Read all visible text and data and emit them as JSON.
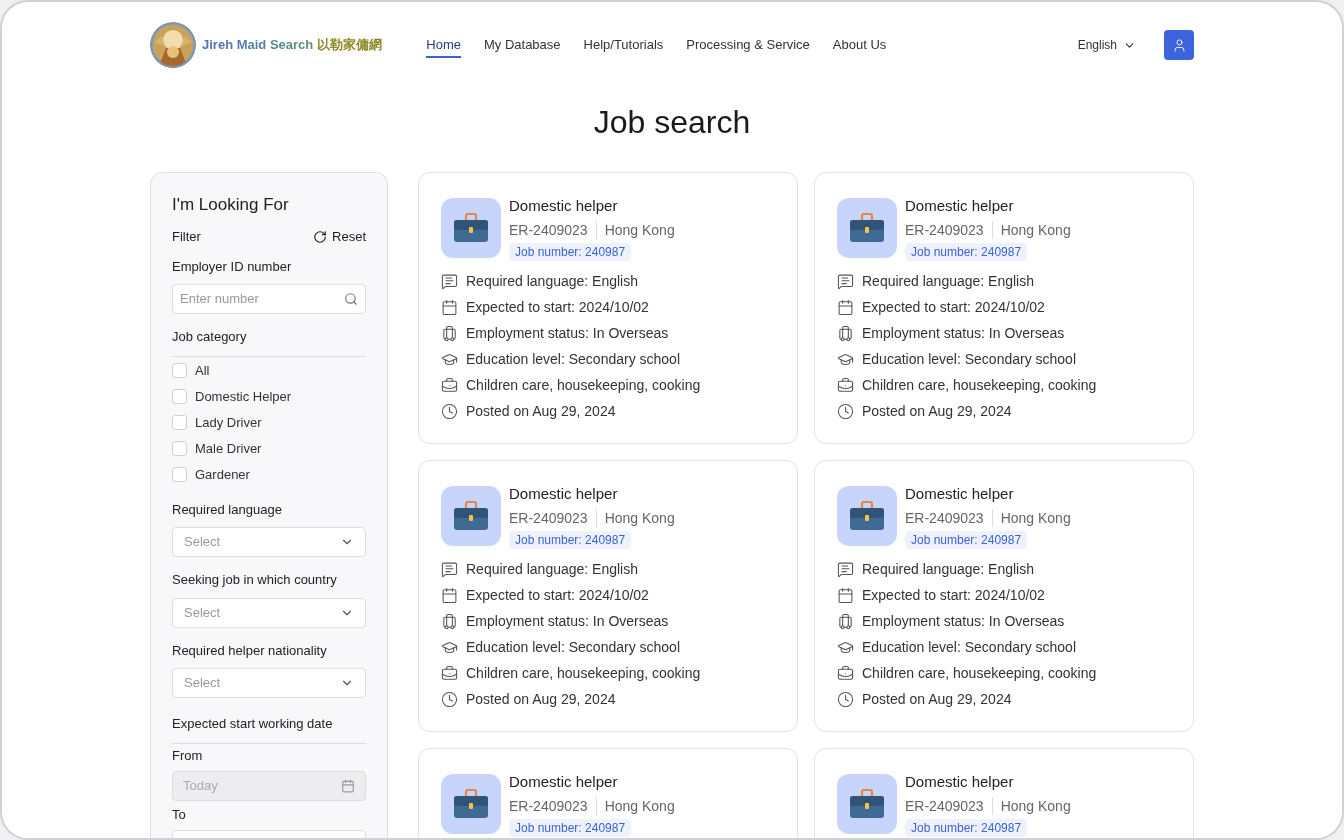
{
  "header": {
    "brand": {
      "name": "Jireh Maid Search",
      "chinese": "以勒家傭網"
    },
    "nav": [
      {
        "label": "Home",
        "selected": true
      },
      {
        "label": "My Database",
        "selected": false
      },
      {
        "label": "Help/Tutorials",
        "selected": false
      },
      {
        "label": "Processing & Service",
        "selected": false
      },
      {
        "label": "About Us",
        "selected": false
      }
    ],
    "language": "English"
  },
  "page_title": "Job search",
  "filters": {
    "title": "I'm Looking For",
    "filter_label": "Filter",
    "reset": "Reset",
    "employer_id": {
      "label": "Employer ID number",
      "placeholder": "Enter number"
    },
    "job_category": {
      "label": "Job category",
      "options": [
        {
          "label": "All",
          "checked": false
        },
        {
          "label": "Domestic Helper",
          "checked": false
        },
        {
          "label": "Lady Driver",
          "checked": false
        },
        {
          "label": "Male Driver",
          "checked": false
        },
        {
          "label": "Gardener",
          "checked": false
        }
      ]
    },
    "selects": [
      {
        "label": "Required language",
        "placeholder": "Select"
      },
      {
        "label": "Seeking job in which country",
        "placeholder": "Select"
      },
      {
        "label": "Required helper nationality",
        "placeholder": "Select"
      }
    ],
    "date": {
      "label": "Expected start working date",
      "fields": [
        {
          "label": "From",
          "placeholder": "Today",
          "disabled": true
        },
        {
          "label": "To"
        }
      ]
    }
  },
  "jobs": [
    {
      "title": "Domestic helper",
      "employer": "ER-2409023",
      "location": "Hong Kong",
      "job_number": "Job number: 240987",
      "details": [
        {
          "kind": "language",
          "text": "Required language: English"
        },
        {
          "kind": "date",
          "text": "Expected to start: 2024/10/02"
        },
        {
          "kind": "status",
          "text": "Employment status: In Overseas"
        },
        {
          "kind": "education",
          "text": "Education level: Secondary school"
        },
        {
          "kind": "duties",
          "text": "Children care, housekeeping, cooking"
        },
        {
          "kind": "posted",
          "text": "Posted on Aug 29, 2024"
        }
      ]
    },
    {
      "title": "Domestic helper",
      "employer": "ER-2409023",
      "location": "Hong Kong",
      "job_number": "Job number: 240987",
      "details": [
        {
          "kind": "language",
          "text": "Required language: English"
        },
        {
          "kind": "date",
          "text": "Expected to start: 2024/10/02"
        },
        {
          "kind": "status",
          "text": "Employment status: In Overseas"
        },
        {
          "kind": "education",
          "text": "Education level: Secondary school"
        },
        {
          "kind": "duties",
          "text": "Children care, housekeeping, cooking"
        },
        {
          "kind": "posted",
          "text": "Posted on Aug 29, 2024"
        }
      ]
    },
    {
      "title": "Domestic helper",
      "employer": "ER-2409023",
      "location": "Hong Kong",
      "job_number": "Job number: 240987",
      "details": [
        {
          "kind": "language",
          "text": "Required language: English"
        },
        {
          "kind": "date",
          "text": "Expected to start: 2024/10/02"
        },
        {
          "kind": "status",
          "text": "Employment status: In Overseas"
        },
        {
          "kind": "education",
          "text": "Education level: Secondary school"
        },
        {
          "kind": "duties",
          "text": "Children care, housekeeping, cooking"
        },
        {
          "kind": "posted",
          "text": "Posted on Aug 29, 2024"
        }
      ]
    },
    {
      "title": "Domestic helper",
      "employer": "ER-2409023",
      "location": "Hong Kong",
      "job_number": "Job number: 240987",
      "details": [
        {
          "kind": "language",
          "text": "Required language: English"
        },
        {
          "kind": "date",
          "text": "Expected to start: 2024/10/02"
        },
        {
          "kind": "status",
          "text": "Employment status: In Overseas"
        },
        {
          "kind": "education",
          "text": "Education level: Secondary school"
        },
        {
          "kind": "duties",
          "text": "Children care, housekeeping, cooking"
        },
        {
          "kind": "posted",
          "text": "Posted on Aug 29, 2024"
        }
      ]
    },
    {
      "title": "Domestic helper",
      "employer": "ER-2409023",
      "location": "Hong Kong",
      "job_number": "Job number: 240987"
    },
    {
      "title": "Domestic helper",
      "employer": "ER-2409023",
      "location": "Hong Kong",
      "job_number": "Job number: 240987"
    }
  ]
}
